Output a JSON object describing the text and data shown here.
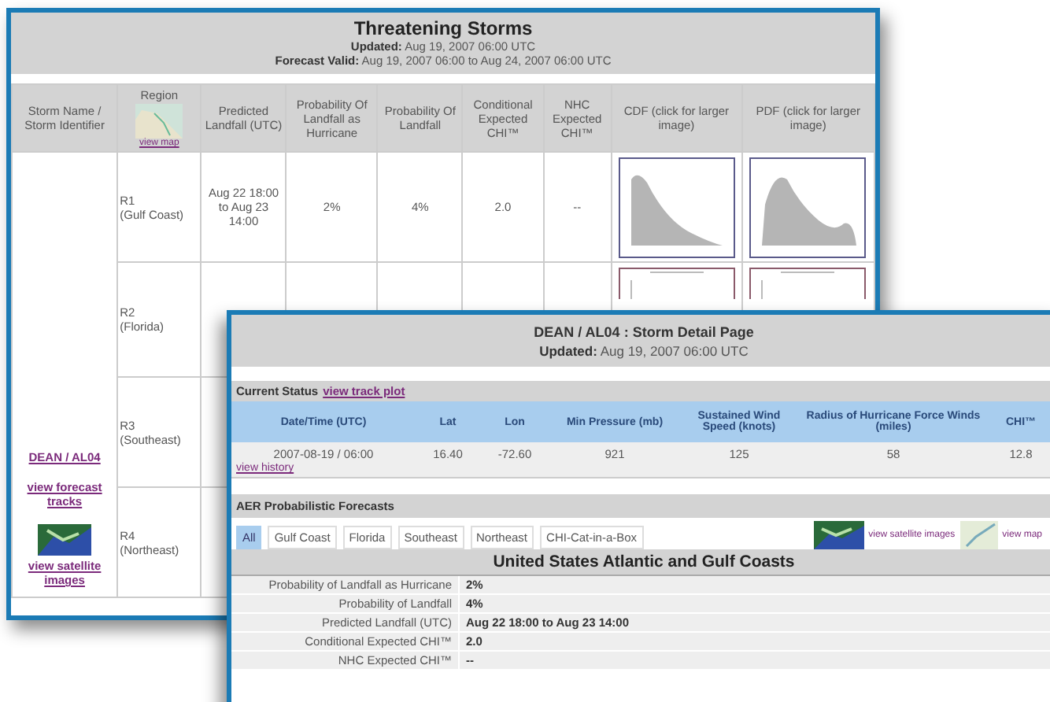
{
  "storms_page": {
    "title": "Threatening Storms",
    "updated_label": "Updated:",
    "updated": "Aug 19, 2007 06:00 UTC",
    "valid_label": "Forecast Valid:",
    "valid": "Aug 19, 2007 06:00 to Aug 24, 2007 06:00 UTC",
    "columns": [
      "Storm Name / Storm Identifier",
      "Region",
      "Predicted Landfall (UTC)",
      "Probability Of Landfall as Hurricane",
      "Probability Of Landfall",
      "Conditional Expected CHI™",
      "NHC Expected CHI™",
      "CDF (click for larger image)",
      "PDF (click for larger image)"
    ],
    "region_link": "view map",
    "storm": {
      "name": "DEAN / AL04",
      "forecast_link": "view forecast tracks",
      "satellite_link": "view satellite images"
    },
    "rows": [
      {
        "region": "R1",
        "region_name": "(Gulf Coast)",
        "landfall": "Aug 22 18:00 to Aug 23 14:00",
        "prob_hurricane": "2%",
        "prob_landfall": "4%",
        "cond_chi": "2.0",
        "nhc_chi": "--",
        "kind": "filled"
      },
      {
        "region": "R2",
        "region_name": "(Florida)",
        "kind": "empty"
      },
      {
        "region": "R3",
        "region_name": "(Southeast)"
      },
      {
        "region": "R4",
        "region_name": "(Northeast)"
      }
    ]
  },
  "detail_page": {
    "title": "DEAN / AL04 : Storm Detail Page",
    "updated_label": "Updated:",
    "updated": "Aug 19, 2007 06:00 UTC",
    "status_label": "Current Status",
    "track_link": "view track plot",
    "columns": [
      "Date/Time (UTC)",
      "Lat",
      "Lon",
      "Min Pressure (mb)",
      "Sustained Wind Speed (knots)",
      "Radius of Hurricane Force Winds (miles)",
      "CHI™"
    ],
    "row": [
      "2007-08-19 / 06:00",
      "16.40",
      "-72.60",
      "921",
      "125",
      "58",
      "12.8"
    ],
    "history_link": "view history",
    "forecast_label": "AER Probabilistic Forecasts",
    "tabs": [
      {
        "label": "All",
        "selected": true
      },
      {
        "label": "Gulf Coast",
        "selected": false
      },
      {
        "label": "Florida",
        "selected": false
      },
      {
        "label": "Southeast",
        "selected": false
      },
      {
        "label": "Northeast",
        "selected": false
      },
      {
        "label": "CHI-Cat-in-a-Box",
        "selected": false
      }
    ],
    "satellite_link": "view satellite images",
    "map_link": "view map",
    "region_heading": "United States Atlantic and Gulf Coasts",
    "details": [
      {
        "label": "Probability of Landfall as Hurricane",
        "value": "2%"
      },
      {
        "label": "Probability of Landfall",
        "value": "4%"
      },
      {
        "label": "Predicted Landfall (UTC)",
        "value": "Aug 22 18:00 to Aug 23 14:00"
      },
      {
        "label": "Conditional Expected CHI™",
        "value": "2.0"
      },
      {
        "label": "NHC Expected CHI™",
        "value": "--"
      }
    ]
  }
}
